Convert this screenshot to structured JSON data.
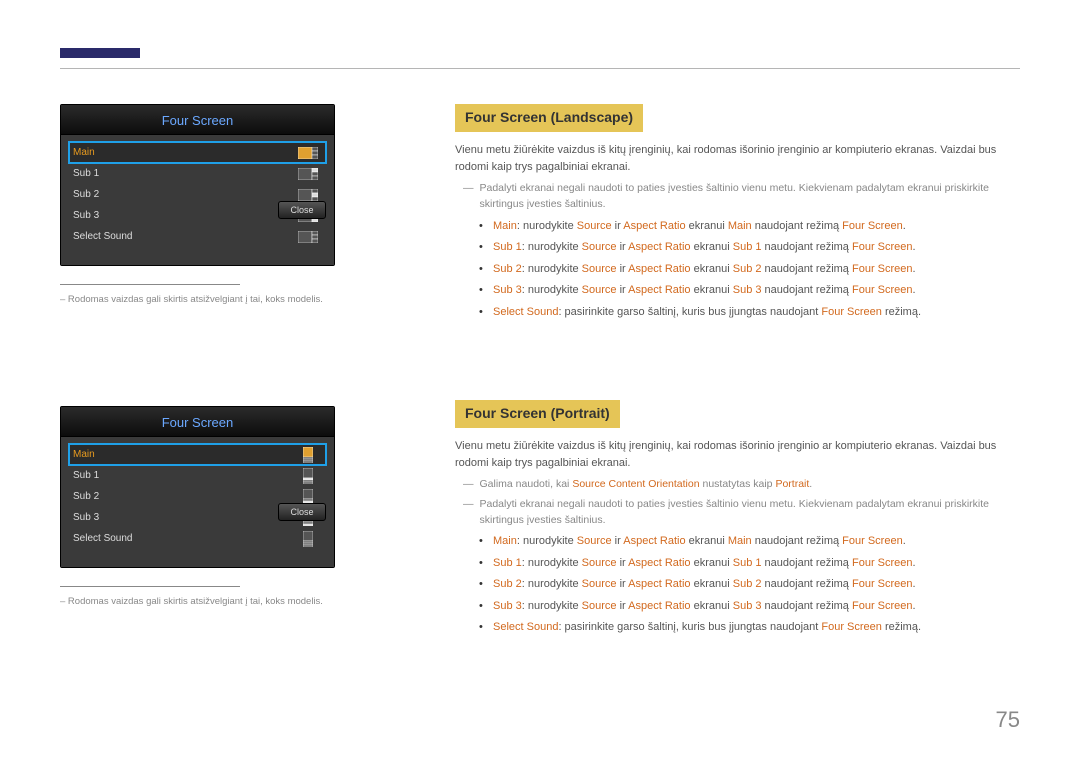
{
  "page_number": "75",
  "osd1": {
    "title": "Four Screen",
    "rows": [
      "Main",
      "Sub 1",
      "Sub 2",
      "Sub 3",
      "Select Sound"
    ],
    "close": "Close"
  },
  "osd2": {
    "title": "Four Screen",
    "rows": [
      "Main",
      "Sub 1",
      "Sub 2",
      "Sub 3",
      "Select Sound"
    ],
    "close": "Close"
  },
  "left_note1": "– Rodomas vaizdas gali skirtis atsižvelgiant į tai, koks modelis.",
  "left_note2": "– Rodomas vaizdas gali skirtis atsižvelgiant į tai, koks modelis.",
  "sec1": {
    "title": "Four Screen (Landscape)",
    "intro": "Vienu metu žiūrėkite vaizdus iš kitų įrenginių, kai rodomas išorinio įrenginio ar kompiuterio ekranas. Vaizdai bus rodomi kaip trys pagalbiniai ekranai.",
    "dash1": "Padalyti ekranai negali naudoti to paties įvesties šaltinio vienu metu. Kiekvienam padalytam ekranui priskirkite skirtingus įvesties šaltinius.",
    "bul": [
      {
        "k": "Main",
        "t1": ": nurodykite ",
        "s": "Source",
        "t2": " ir ",
        "a": "Aspect Ratio",
        "t3": " ekranui ",
        "k2": "Main",
        "t4": " naudojant režimą ",
        "f": "Four Screen",
        "t5": "."
      },
      {
        "k": "Sub 1",
        "t1": ": nurodykite ",
        "s": "Source",
        "t2": " ir ",
        "a": "Aspect Ratio",
        "t3": " ekranui ",
        "k2": "Sub 1",
        "t4": " naudojant režimą ",
        "f": "Four Screen",
        "t5": "."
      },
      {
        "k": "Sub 2",
        "t1": ": nurodykite ",
        "s": "Source",
        "t2": " ir ",
        "a": "Aspect Ratio",
        "t3": " ekranui ",
        "k2": "Sub 2",
        "t4": " naudojant režimą ",
        "f": "Four Screen",
        "t5": "."
      },
      {
        "k": "Sub 3",
        "t1": ": nurodykite ",
        "s": "Source",
        "t2": " ir ",
        "a": "Aspect Ratio",
        "t3": " ekranui ",
        "k2": "Sub 3",
        "t4": " naudojant režimą ",
        "f": "Four Screen",
        "t5": "."
      }
    ],
    "last": {
      "k": "Select Sound",
      "t1": ": pasirinkite garso šaltinį, kuris bus įjungtas naudojant ",
      "f": "Four Screen",
      "t2": " režimą."
    }
  },
  "sec2": {
    "title": "Four Screen (Portrait)",
    "intro": "Vienu metu žiūrėkite vaizdus iš kitų įrenginių, kai rodomas išorinio įrenginio ar kompiuterio ekranas. Vaizdai bus rodomi kaip trys pagalbiniai ekranai.",
    "dash1a": "Galima naudoti, kai ",
    "dash1b": "Source Content Orientation",
    "dash1c": " nustatytas kaip ",
    "dash1d": "Portrait",
    "dash1e": ".",
    "dash2": "Padalyti ekranai negali naudoti to paties įvesties šaltinio vienu metu. Kiekvienam padalytam ekranui priskirkite skirtingus įvesties šaltinius.",
    "bul": [
      {
        "k": "Main",
        "t1": ": nurodykite ",
        "s": "Source",
        "t2": " ir ",
        "a": "Aspect Ratio",
        "t3": " ekranui ",
        "k2": "Main",
        "t4": " naudojant režimą ",
        "f": "Four Screen",
        "t5": "."
      },
      {
        "k": "Sub 1",
        "t1": ": nurodykite ",
        "s": "Source",
        "t2": " ir ",
        "a": "Aspect Ratio",
        "t3": " ekranui ",
        "k2": "Sub 1",
        "t4": " naudojant režimą ",
        "f": "Four Screen",
        "t5": "."
      },
      {
        "k": "Sub 2",
        "t1": ": nurodykite ",
        "s": "Source",
        "t2": " ir ",
        "a": "Aspect Ratio",
        "t3": " ekranui ",
        "k2": "Sub 2",
        "t4": " naudojant režimą ",
        "f": "Four Screen",
        "t5": "."
      },
      {
        "k": "Sub 3",
        "t1": ": nurodykite ",
        "s": "Source",
        "t2": " ir ",
        "a": "Aspect Ratio",
        "t3": " ekranui ",
        "k2": "Sub 3",
        "t4": " naudojant režimą ",
        "f": "Four Screen",
        "t5": "."
      }
    ],
    "last": {
      "k": "Select Sound",
      "t1": ": pasirinkite garso šaltinį, kuris bus įjungtas naudojant ",
      "f": "Four Screen",
      "t2": " režimą."
    }
  }
}
